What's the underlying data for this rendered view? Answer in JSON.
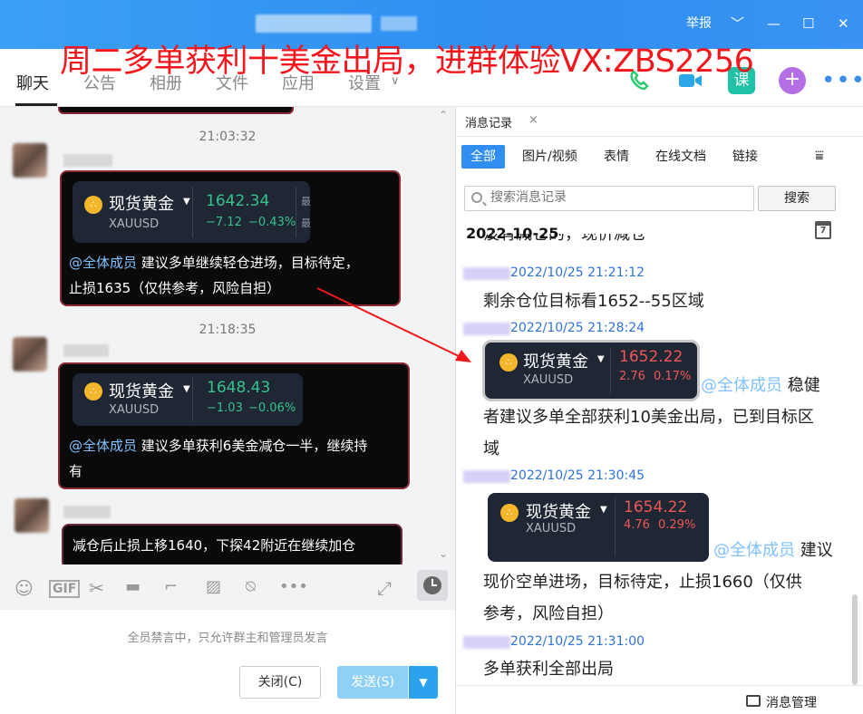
{
  "window": {
    "report": "举报",
    "chev": "﹀",
    "minimize": "—",
    "maximize": "☐",
    "close": "✕"
  },
  "overlay": "周二多单获利十美金出局，进群体验VX:ZBS2256",
  "nav": {
    "tabs": [
      "聊天",
      "公告",
      "相册",
      "文件",
      "应用",
      "设置"
    ],
    "settings_caret": "∨",
    "more": "•••"
  },
  "chat": {
    "times": [
      "21:03:32",
      "21:18:35"
    ],
    "msg1": {
      "card": {
        "name": "现货黄金",
        "symbol": "XAUUSD",
        "price": "1642.34",
        "change": "−7.12",
        "pct": "−0.43%",
        "side": [
          "最",
          "最"
        ]
      },
      "at": "@全体成员",
      "line1": " 建议多单继续轻仓进场，目标待定，",
      "line2": "止损1635（仅供参考，风险自担）"
    },
    "msg2": {
      "card": {
        "name": "现货黄金",
        "symbol": "XAUUSD",
        "price": "1648.43",
        "change": "−1.03",
        "pct": "−0.06%"
      },
      "at": "@全体成员",
      "line1": " 建议多单获利6美金减仓一半，继续持",
      "line2": "有"
    },
    "msg3": {
      "text": "减仓后止损上移1640，下探42附近在继续加仓"
    }
  },
  "input": {
    "mute_note": "全员禁言中，只允许群主和管理员发言",
    "close_label": "关闭(C)",
    "send_label": "发送(S)",
    "toolbar_icons": [
      "emoji-icon",
      "gif-icon",
      "scissors-icon",
      "folder-icon",
      "screenshot-icon",
      "image-icon",
      "mute-icon",
      "more-icon",
      "expand-icon",
      "history-icon"
    ]
  },
  "records": {
    "tab": "消息记录",
    "tab_close": "×",
    "filters": [
      "全部",
      "图片/视频",
      "表情",
      "在线文档",
      "链接"
    ],
    "search_placeholder": "搜索消息记录",
    "search_btn": "搜索",
    "date": "2022-10-25",
    "cal_day": "7",
    "clipped": "没有减仓的，现价减仓",
    "items": [
      {
        "time": "2022/10/25 21:21:12",
        "text": "剩余仓位目标看1652--55区域"
      },
      {
        "time": "2022/10/25 21:28:24"
      },
      {
        "time": "2022/10/25 21:30:45"
      },
      {
        "time": "2022/10/25 21:31:00",
        "text": "多单获利全部出局"
      }
    ],
    "card1": {
      "name": "现货黄金",
      "symbol": "XAUUSD",
      "price": "1652.22",
      "change": "2.76",
      "pct": "0.17%"
    },
    "msg_a": {
      "at": "@全体成员",
      "l1": " 稳健",
      "l2": "者建议多单全部获利10美金出局，已到目标区",
      "l3": "域"
    },
    "card2": {
      "name": "现货黄金",
      "symbol": "XAUUSD",
      "price": "1654.22",
      "change": "4.76",
      "pct": "0.29%"
    },
    "msg_b": {
      "at": "@全体成员",
      "l1": " 建议",
      "l2": "现价空单进场，目标待定，止损1660（仅供",
      "l3": "参考，风险自担）"
    },
    "manage": "消息管理"
  },
  "colors": {
    "accent": "#2f8ef0",
    "overlay": "#f4161d",
    "up": "#f05656",
    "down": "#35c28b"
  }
}
